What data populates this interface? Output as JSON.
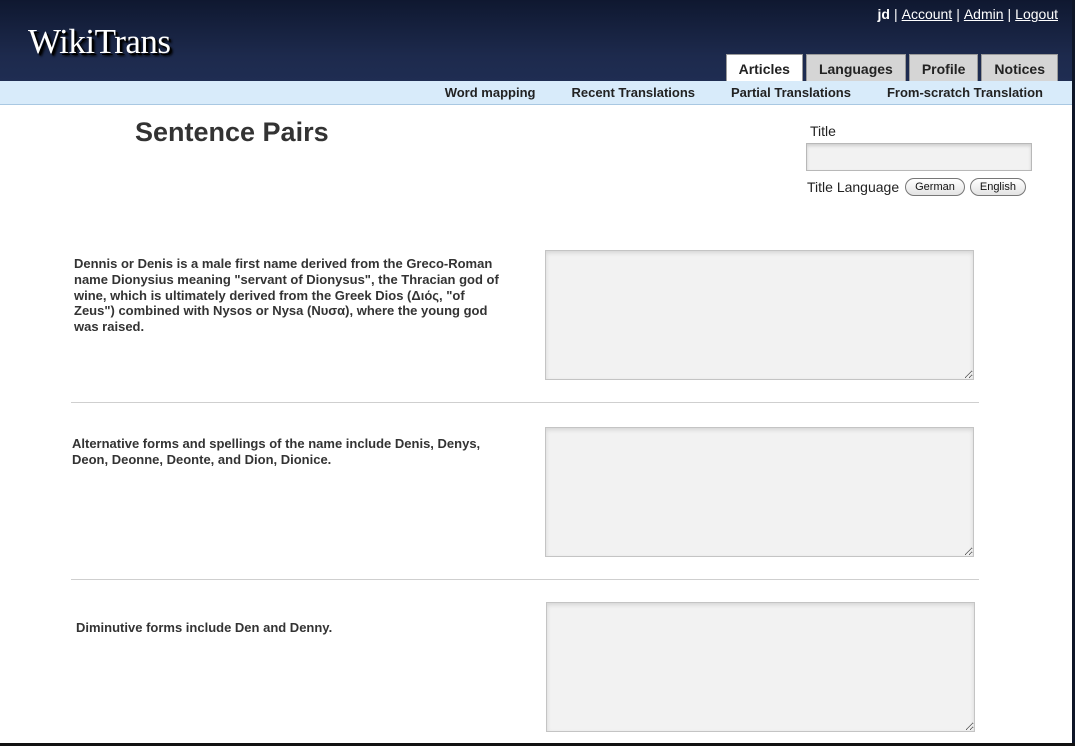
{
  "app": {
    "logo": "WikiTrans"
  },
  "userbar": {
    "username": "jd",
    "separator": "|",
    "links": [
      "Account",
      "Admin",
      "Logout"
    ]
  },
  "tabs": [
    {
      "label": "Articles",
      "active": true
    },
    {
      "label": "Languages",
      "active": false
    },
    {
      "label": "Profile",
      "active": false
    },
    {
      "label": "Notices",
      "active": false
    }
  ],
  "subnav": [
    "Word mapping",
    "Recent Translations",
    "Partial Translations",
    "From-scratch Translation"
  ],
  "page": {
    "title": "Sentence Pairs",
    "title_field_label": "Title",
    "title_field_value": "",
    "title_language_label": "Title Language",
    "language_buttons": [
      "German",
      "English"
    ]
  },
  "sentences": [
    {
      "source": "Dennis or Denis is a male first name derived from the Greco-Roman name Dionysius meaning \"servant of Dionysus\", the Thracian god of wine, which is ultimately derived from the Greek Dios (Διός, \"of Zeus\") combined with Nysos or Nysa (Νυσα), where the young god was raised.",
      "translation": ""
    },
    {
      "source": "Alternative forms and spellings of the name include Denis, Denys, Deon, Deonne, Deonte, and Dion, Dionice.",
      "translation": ""
    },
    {
      "source": "Diminutive forms include Den and Denny.",
      "translation": ""
    }
  ],
  "colors": {
    "header_bg": "#1d2a4d",
    "subnav_bg": "#d8ebfa",
    "tab_bg": "#d5d5d5",
    "input_bg": "#f2f2f2"
  }
}
